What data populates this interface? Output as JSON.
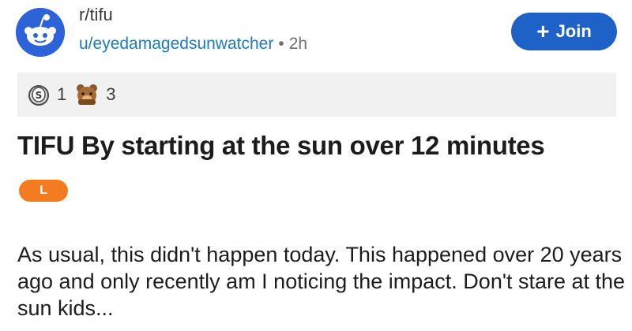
{
  "header": {
    "subreddit": "r/tifu",
    "username": "u/eyedamagedsunwatcher",
    "separator": "•",
    "age": "2h",
    "join_label": "Join",
    "join_icon": "plus-icon"
  },
  "awards": [
    {
      "icon": "silver-coin-award-icon",
      "count": "1"
    },
    {
      "icon": "bear-award-icon",
      "count": "3"
    }
  ],
  "post": {
    "title": "TIFU By starting at the sun over 12 minutes",
    "flair": "L",
    "body": "As usual, this didn't happen today. This happened over 20 years ago and only recently am I noticing the impact. Don't stare at the sun kids..."
  },
  "colors": {
    "accent": "#1e62c8",
    "avatar_bg": "#2e62d9",
    "link": "#1a7bbd",
    "flair": "#f47c20",
    "award_bar": "#f1f1f1"
  }
}
